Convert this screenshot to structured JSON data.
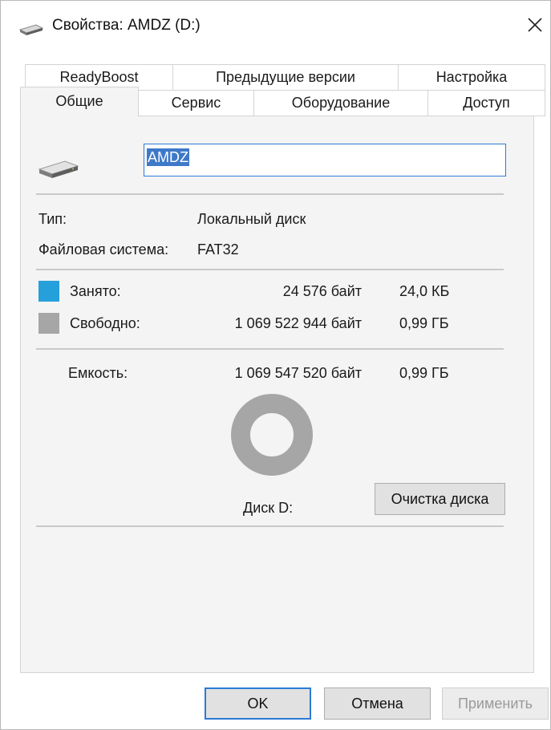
{
  "window": {
    "title": "Свойства: AMDZ (D:)",
    "close_glyph": "✕"
  },
  "tabs_row1": [
    "ReadyBoost",
    "Предыдущие версии",
    "Настройка"
  ],
  "tabs_row2": [
    "Общие",
    "Сервис",
    "Оборудование",
    "Доступ"
  ],
  "active_tab": "Общие",
  "general": {
    "volume_name": "AMDZ",
    "type_label": "Тип:",
    "type_value": "Локальный диск",
    "fs_label": "Файловая система:",
    "fs_value": "FAT32",
    "used_label": "Занято:",
    "used_bytes": "24 576 байт",
    "used_size": "24,0 КБ",
    "free_label": "Свободно:",
    "free_bytes": "1 069 522 944 байт",
    "free_size": "0,99 ГБ",
    "capacity_label": "Емкость:",
    "capacity_bytes": "1 069 547 520 байт",
    "capacity_size": "0,99 ГБ",
    "disk_label": "Диск D:",
    "cleanup_button": "Очистка диска",
    "used_fraction": 2.3e-05
  },
  "colors": {
    "used": "#26a0da",
    "free": "#a6a6a6"
  },
  "icons": {
    "title": "drive-icon",
    "large": "drive-icon",
    "close": "close-icon"
  },
  "footer": {
    "ok": "OK",
    "cancel": "Отмена",
    "apply": "Применить"
  }
}
